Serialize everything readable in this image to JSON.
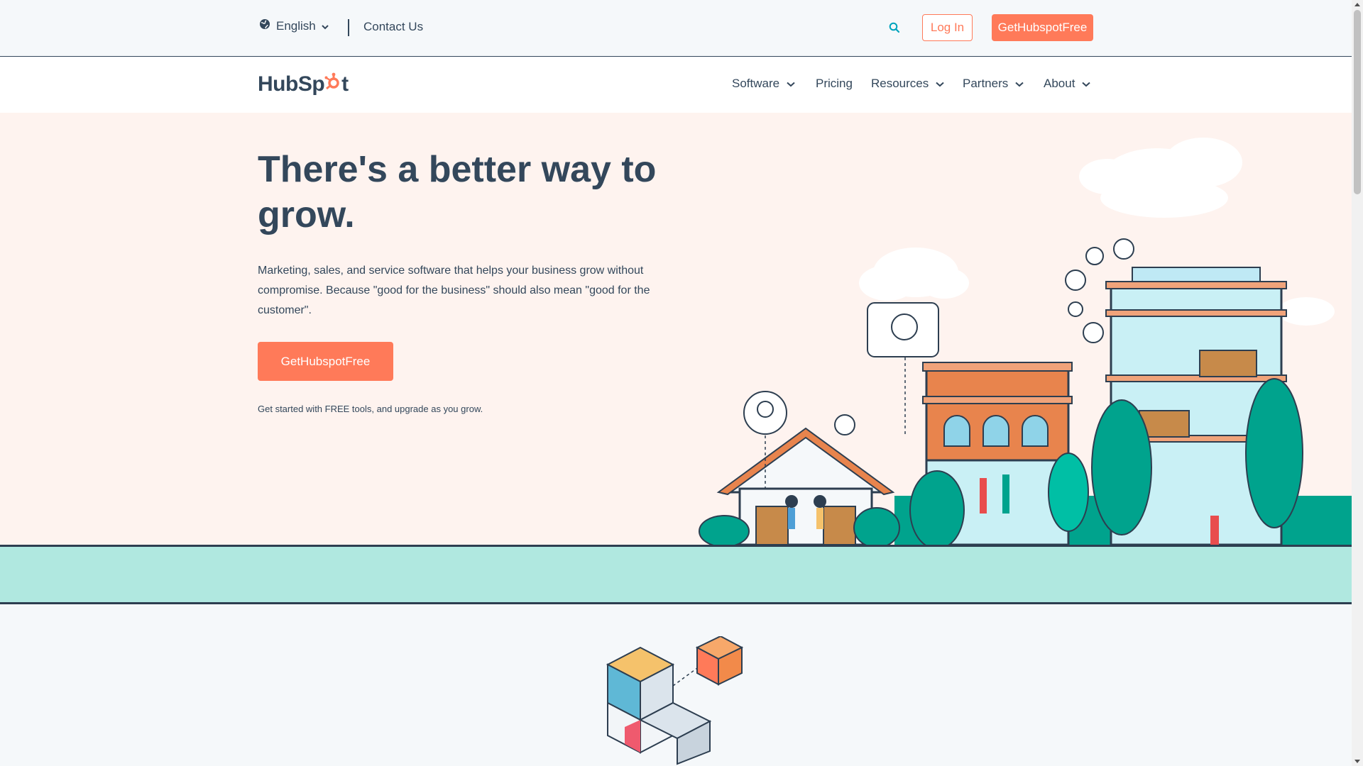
{
  "utility": {
    "language": "English",
    "contact": "Contact Us",
    "login": "Log In",
    "cta": "GetHubspotFree"
  },
  "nav": {
    "logo_left": "HubSp",
    "logo_sprocket": "✱",
    "logo_right": "t",
    "items": [
      {
        "label": "Software",
        "dropdown": true
      },
      {
        "label": "Pricing",
        "dropdown": false
      },
      {
        "label": "Resources",
        "dropdown": true
      },
      {
        "label": "Partners",
        "dropdown": true
      },
      {
        "label": "About",
        "dropdown": true
      }
    ]
  },
  "hero": {
    "title": "There's a better way to grow.",
    "description": "Marketing, sales, and service software that helps your business grow without compromise. Because \"good for the business\" should also mean \"good for the customer\".",
    "cta": "GetHubspotFree",
    "note": "Get started with FREE tools, and upgrade as you grow."
  },
  "colors": {
    "accent": "#ff7a59",
    "text": "#33475b",
    "hero_bg": "#fef3ef",
    "band": "#b0e8e0",
    "teal": "#00a4bd"
  },
  "icons": [
    "globe-icon",
    "chevron-down-icon",
    "search-icon",
    "sprocket-icon"
  ]
}
